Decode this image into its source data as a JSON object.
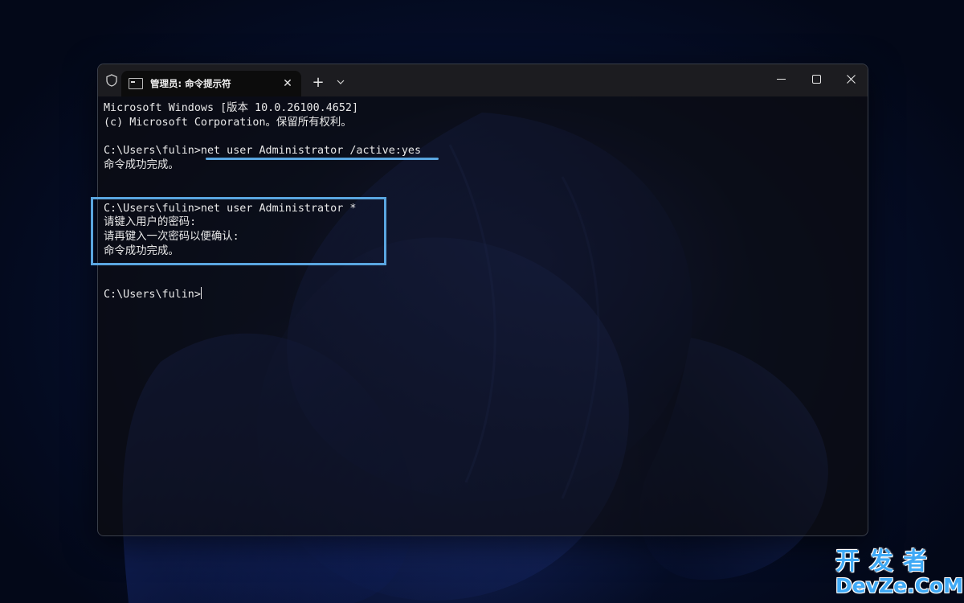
{
  "colors": {
    "accent": "#5aa6e0",
    "terminal_text": "#e8e8e8",
    "watermark": "#3fa9f5"
  },
  "titlebar": {
    "shield_icon": "shield-icon",
    "tab": {
      "icon": "command-prompt-icon",
      "title": "管理员: 命令提示符",
      "close_label": "✕"
    },
    "new_tab_label": "+",
    "dropdown_icon": "chevron-down-icon",
    "window_controls": {
      "minimize_icon": "minimize-icon",
      "maximize_icon": "maximize-icon",
      "close_icon": "close-icon"
    }
  },
  "terminal": {
    "lines": [
      "Microsoft Windows [版本 10.0.26100.4652]",
      "(c) Microsoft Corporation。保留所有权利。",
      "",
      "C:\\Users\\fulin>net user Administrator /active:yes",
      "命令成功完成。",
      "",
      "",
      "C:\\Users\\fulin>net user Administrator *",
      "请键入用户的密码:",
      "请再键入一次密码以便确认:",
      "命令成功完成。",
      "",
      ""
    ],
    "prompt": "C:\\Users\\fulin>"
  },
  "watermark": {
    "chinese": "开发者",
    "english": "DevZe.CoM"
  }
}
